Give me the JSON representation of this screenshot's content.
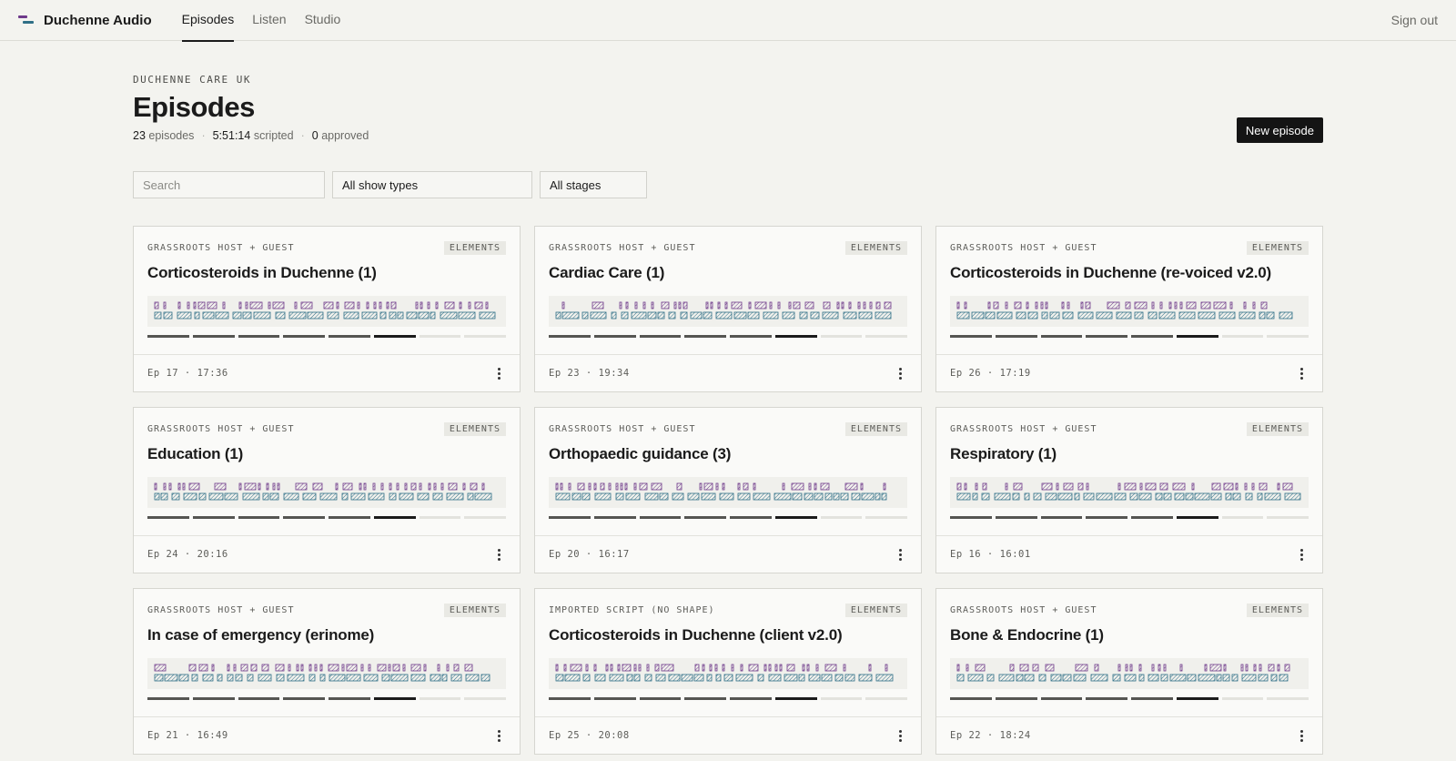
{
  "app": {
    "name": "Duchenne Audio",
    "sign_out": "Sign out"
  },
  "nav": [
    {
      "label": "Episodes",
      "active": true
    },
    {
      "label": "Listen",
      "active": false
    },
    {
      "label": "Studio",
      "active": false
    }
  ],
  "header": {
    "eyebrow": "DUCHENNE CARE UK",
    "title": "Episodes",
    "stats": {
      "episodes_value": "23",
      "episodes_label": "episodes",
      "scripted_value": "5:51:14",
      "scripted_label": "scripted",
      "approved_value": "0",
      "approved_label": "approved",
      "separator": "·"
    },
    "new_button": "New episode"
  },
  "filters": {
    "search_placeholder": "Search",
    "show_types": "All show types",
    "stages": "All stages"
  },
  "colors": {
    "host": "#6e3a8a",
    "guest": "#2f6f86",
    "button": "#141414"
  },
  "icons": {
    "card_menu": "kebab-icon",
    "logo": "duchenne-logo-icon"
  },
  "cards": [
    {
      "kind": "GRASSROOTS HOST + GUEST",
      "badge": "ELEMENTS",
      "title": "Corticosteroids in Duchenne (1)",
      "meta": "Ep 17 · 17:36",
      "stage": 6,
      "stages_total": 8
    },
    {
      "kind": "GRASSROOTS HOST + GUEST",
      "badge": "ELEMENTS",
      "title": "Cardiac Care (1)",
      "meta": "Ep 23 · 19:34",
      "stage": 6,
      "stages_total": 8
    },
    {
      "kind": "GRASSROOTS HOST + GUEST",
      "badge": "ELEMENTS",
      "title": "Corticosteroids in Duchenne (re-voiced v2.0)",
      "meta": "Ep 26 · 17:19",
      "stage": 6,
      "stages_total": 8
    },
    {
      "kind": "GRASSROOTS HOST + GUEST",
      "badge": "ELEMENTS",
      "title": "Education (1)",
      "meta": "Ep 24 · 20:16",
      "stage": 6,
      "stages_total": 8
    },
    {
      "kind": "GRASSROOTS HOST + GUEST",
      "badge": "ELEMENTS",
      "title": "Orthopaedic guidance (3)",
      "meta": "Ep 20 · 16:17",
      "stage": 6,
      "stages_total": 8
    },
    {
      "kind": "GRASSROOTS HOST + GUEST",
      "badge": "ELEMENTS",
      "title": "Respiratory (1)",
      "meta": "Ep 16 · 16:01",
      "stage": 6,
      "stages_total": 8
    },
    {
      "kind": "GRASSROOTS HOST + GUEST",
      "badge": "ELEMENTS",
      "title": "In case of emergency (erinome)",
      "meta": "Ep 21 · 16:49",
      "stage": 6,
      "stages_total": 8
    },
    {
      "kind": "IMPORTED SCRIPT (NO SHAPE)",
      "badge": "ELEMENTS",
      "title": "Corticosteroids in Duchenne (client v2.0)",
      "meta": "Ep 25 · 20:08",
      "stage": 6,
      "stages_total": 8
    },
    {
      "kind": "GRASSROOTS HOST + GUEST",
      "badge": "ELEMENTS",
      "title": "Bone & Endocrine (1)",
      "meta": "Ep 22 · 18:24",
      "stage": 6,
      "stages_total": 8
    }
  ]
}
